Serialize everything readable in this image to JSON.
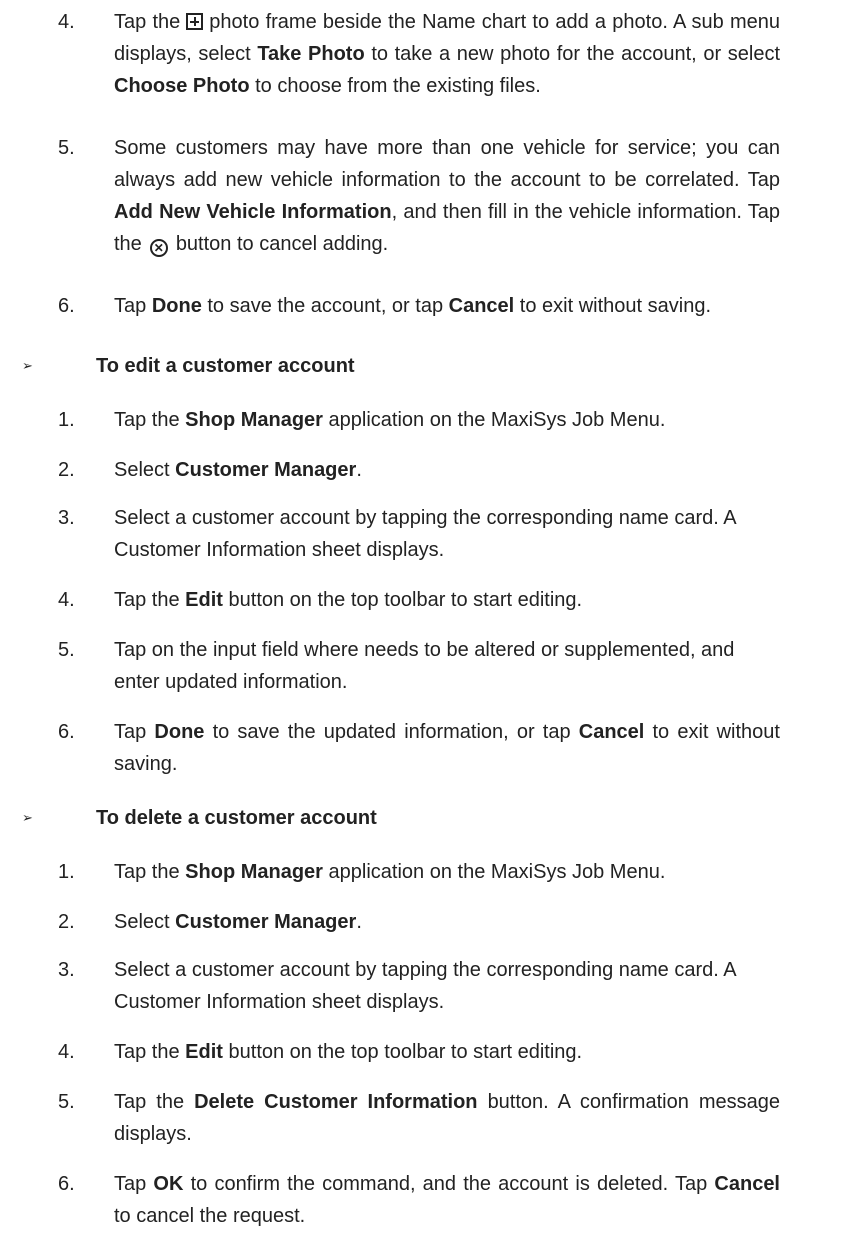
{
  "section1_tail": {
    "steps": [
      {
        "num": "4.",
        "a": "Tap the",
        "icon": "plus-box-icon",
        "b": "photo frame beside the Name chart to add a photo. A sub menu displays, select",
        "c": "Take Photo",
        "d": "to take a new photo for the account, or select",
        "e": "Choose Photo",
        "f": "to choose from the existing files."
      },
      {
        "num": "5.",
        "a": "Some customers may have more than one vehicle for service; you can always add new vehicle information to the account to be correlated. Tap",
        "b": "Add New Vehicle Information",
        "c": ", and then fill in the vehicle information. Tap the",
        "icon": "x-circle-icon",
        "d": "button to cancel adding."
      },
      {
        "num": "6.",
        "a": "Tap",
        "b": "Done",
        "c": "to save the account, or tap",
        "d": "Cancel",
        "e": "to exit without saving."
      }
    ]
  },
  "edit_section": {
    "heading": "To edit a customer account",
    "steps": [
      {
        "num": "1.",
        "a": "Tap the",
        "b": "Shop Manager",
        "c": "application on the MaxiSys Job Menu."
      },
      {
        "num": "2.",
        "a": "Select",
        "b": "Customer Manager",
        "c": "."
      },
      {
        "num": "3.",
        "a": "Select a customer account by tapping the corresponding name card. A Customer Information sheet displays."
      },
      {
        "num": "4.",
        "a": "Tap the",
        "b": "Edit",
        "c": "button on the top toolbar to start editing."
      },
      {
        "num": "5.",
        "a": "Tap on the input field where needs to be altered or supplemented, and enter updated information."
      },
      {
        "num": "6.",
        "a": "Tap",
        "b": "Done",
        "c": "to save the updated information, or tap",
        "d": "Cancel",
        "e": "to exit without saving."
      }
    ]
  },
  "delete_section": {
    "heading": "To delete a customer account",
    "steps": [
      {
        "num": "1.",
        "a": "Tap the",
        "b": "Shop Manager",
        "c": "application on the MaxiSys Job Menu."
      },
      {
        "num": "2.",
        "a": "Select",
        "b": "Customer Manager",
        "c": "."
      },
      {
        "num": "3.",
        "a": "Select a customer account by tapping the corresponding name card. A Customer Information sheet displays."
      },
      {
        "num": "4.",
        "a": "Tap the",
        "b": "Edit",
        "c": "button on the top toolbar to start editing."
      },
      {
        "num": "5.",
        "a": "Tap the",
        "b": "Delete Customer Information",
        "c": "button. A confirmation message displays."
      },
      {
        "num": "6.",
        "a": "Tap",
        "b": "OK",
        "c": "to confirm the command, and the account is deleted. Tap",
        "d": "Cancel",
        "e": "to cancel the request."
      }
    ]
  },
  "icons": {
    "bullet": "arrow-bullet-icon",
    "bullet_glyph": "➢"
  }
}
